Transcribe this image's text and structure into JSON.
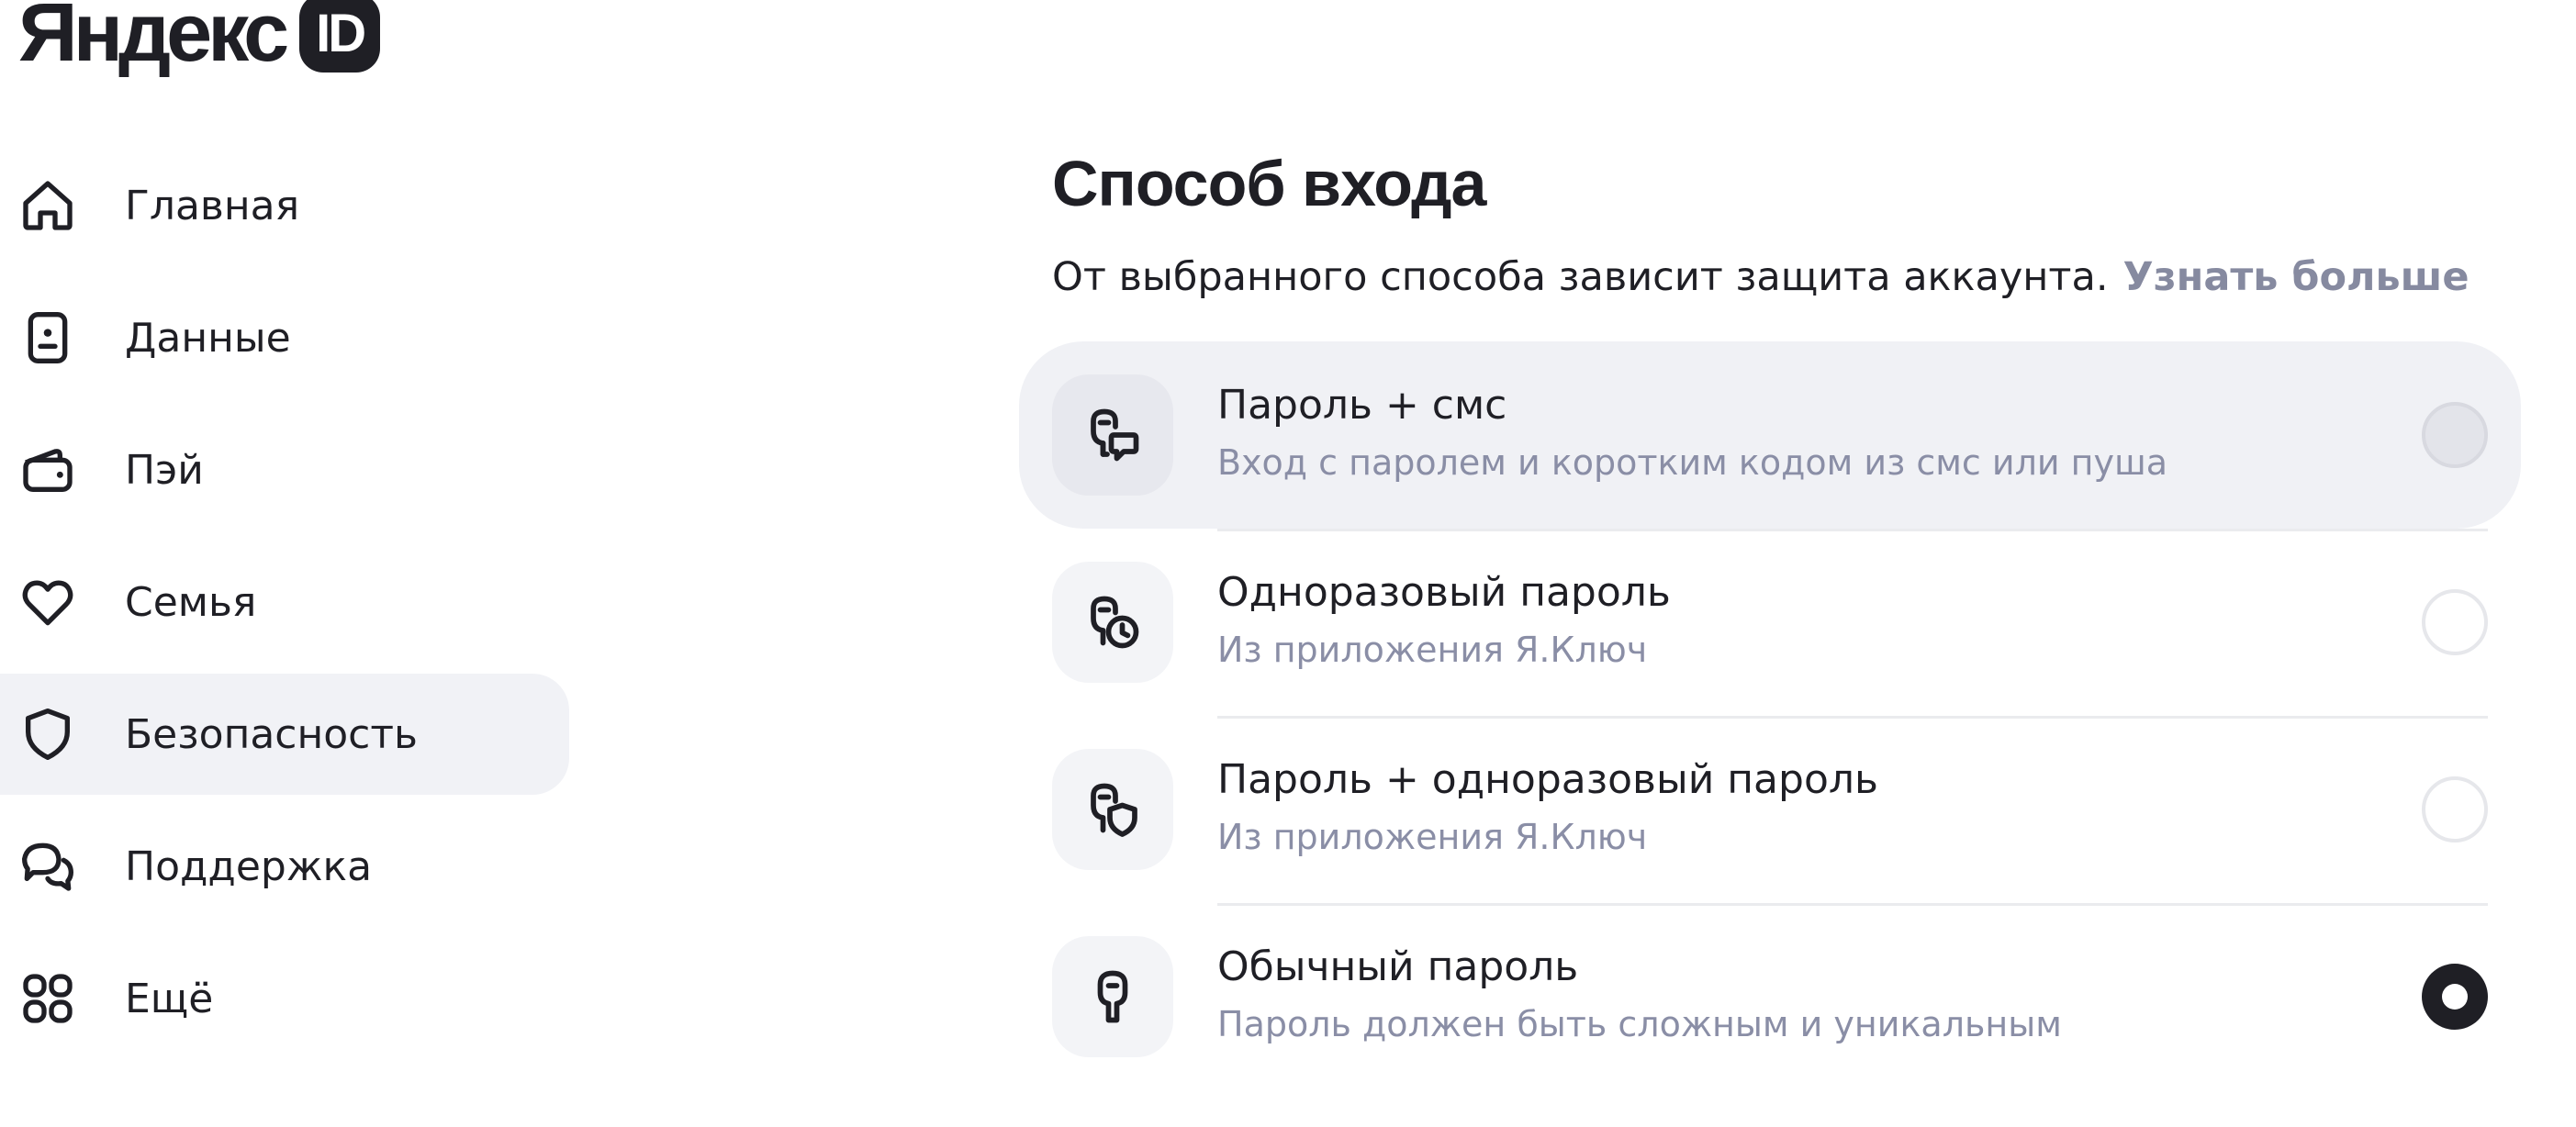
{
  "logo": {
    "text": "Яндекс",
    "badge": "ID"
  },
  "sidebar": {
    "items": [
      {
        "label": "Главная",
        "icon": "home-icon",
        "active": false
      },
      {
        "label": "Данные",
        "icon": "id-card-icon",
        "active": false
      },
      {
        "label": "Пэй",
        "icon": "wallet-icon",
        "active": false
      },
      {
        "label": "Семья",
        "icon": "heart-icon",
        "active": false
      },
      {
        "label": "Безопасность",
        "icon": "shield-icon",
        "active": true
      },
      {
        "label": "Поддержка",
        "icon": "chat-bubbles-icon",
        "active": false
      },
      {
        "label": "Ещё",
        "icon": "grid-icon",
        "active": false
      }
    ]
  },
  "main": {
    "title": "Способ входа",
    "subtitle": "От выбранного способа зависит защита аккаунта.",
    "learn_more": "Узнать больше",
    "options": [
      {
        "title": "Пароль + смс",
        "description": "Вход с паролем и коротким кодом из смс или пуша",
        "icon": "key-message-icon",
        "selected": false,
        "highlighted": true
      },
      {
        "title": "Одноразовый пароль",
        "description": "Из приложения Я.Ключ",
        "icon": "key-clock-icon",
        "selected": false,
        "highlighted": false
      },
      {
        "title": "Пароль + одноразовый пароль",
        "description": "Из приложения Я.Ключ",
        "icon": "key-shield-icon",
        "selected": false,
        "highlighted": false
      },
      {
        "title": "Обычный пароль",
        "description": "Пароль должен быть сложным и уникальным",
        "icon": "key-icon",
        "selected": true,
        "highlighted": false
      }
    ]
  },
  "colors": {
    "text": "#1f1f25",
    "muted": "#8a8ea6",
    "link": "#868aa0",
    "active_bg": "#f1f2f6"
  }
}
